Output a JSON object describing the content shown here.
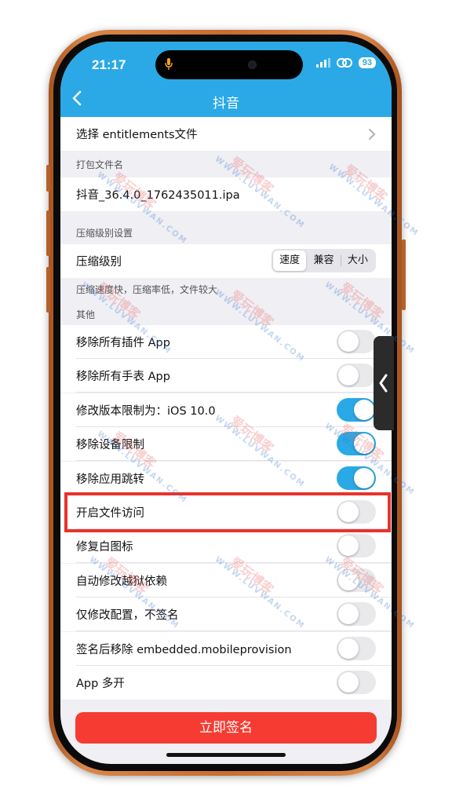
{
  "status_bar": {
    "time": "21:17",
    "battery": "93"
  },
  "navbar": {
    "title": "抖音"
  },
  "rows": {
    "entitlements": "选择 entitlements文件",
    "package_section": "打包文件名",
    "package_file": "抖音_36.4.0_1762435011.ipa",
    "compression_section": "压缩级别设置",
    "compression_label": "压缩级别",
    "compression_options": [
      "速度",
      "兼容",
      "大小"
    ],
    "compression_selected": "速度",
    "compression_hint": "压缩速度快，压缩率低，文件较大",
    "other_section": "其他"
  },
  "toggles": [
    {
      "label": "移除所有插件 App",
      "on": false
    },
    {
      "label": "移除所有手表 App",
      "on": false
    },
    {
      "label": "修改版本限制为：iOS 10.0",
      "on": true
    },
    {
      "label": "移除设备限制",
      "on": true
    },
    {
      "label": "移除应用跳转",
      "on": true
    },
    {
      "label": "开启文件访问",
      "on": false
    },
    {
      "label": "修复白图标",
      "on": false
    },
    {
      "label": "自动修改越狱依赖",
      "on": false
    },
    {
      "label": "仅修改配置，不签名",
      "on": false
    },
    {
      "label": "签名后移除 embedded.mobileprovision",
      "on": false
    },
    {
      "label": "App 多开",
      "on": false
    }
  ],
  "actions": {
    "sign_now": "立即签名"
  },
  "watermark": {
    "brand": "爱玩博客",
    "url": "WWW.LUVWAN.COM"
  },
  "colors": {
    "accent": "#2aa9e6",
    "danger": "#f63b32",
    "highlight": "#e8322c",
    "frame": "#c86d2e"
  }
}
